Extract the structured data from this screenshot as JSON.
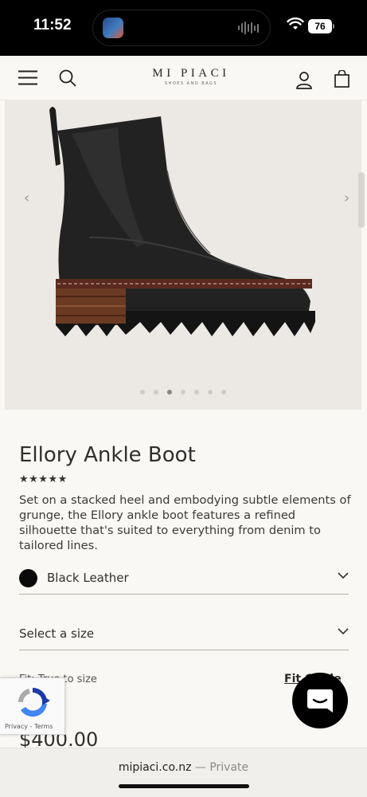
{
  "status_bar": {
    "time": "11:52",
    "battery": "76"
  },
  "header": {
    "logo_main": "MI PIACI",
    "logo_sub": "SHOES AND BAGS"
  },
  "gallery": {
    "image_icon": "ankle-boot-image",
    "dot_count": 7,
    "active_dot": 3
  },
  "product": {
    "title": "Ellory Ankle Boot",
    "rating_stars": "★★★★★",
    "description": "Set on a stacked heel and embodying subtle elements of grunge, the Ellory ankle boot features a refined silhouette that's suited to everything from denim to tailored lines.",
    "color_label": "Black Leather",
    "size_label": "Select a size",
    "fit_text": "Fit: True to size",
    "fit_link": "Fit Guide",
    "price": "$400.00"
  },
  "recaptcha": {
    "links": "Privacy - Terms"
  },
  "browser": {
    "url": "mipiaci.co.nz",
    "mode": "— Private"
  },
  "colors": {
    "swatch": "#0a0a0a",
    "background": "#faf8f4"
  }
}
